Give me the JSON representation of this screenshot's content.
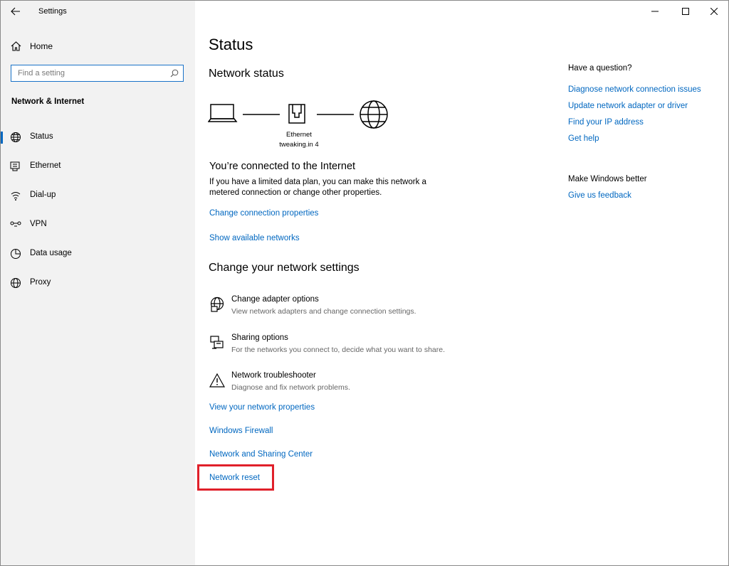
{
  "window": {
    "title": "Settings"
  },
  "sidebar": {
    "home_label": "Home",
    "search_placeholder": "Find a setting",
    "section_title": "Network & Internet",
    "items": [
      {
        "label": "Status",
        "icon": "globe-status-icon",
        "active": true
      },
      {
        "label": "Ethernet",
        "icon": "ethernet-icon"
      },
      {
        "label": "Dial-up",
        "icon": "dialup-icon"
      },
      {
        "label": "VPN",
        "icon": "vpn-icon"
      },
      {
        "label": "Data usage",
        "icon": "data-usage-icon"
      },
      {
        "label": "Proxy",
        "icon": "globe-icon"
      }
    ]
  },
  "main": {
    "title": "Status",
    "network_status_heading": "Network status",
    "diagram": {
      "adapter_name": "Ethernet",
      "network_name": "tweaking.in 4"
    },
    "connected_heading": "You’re connected to the Internet",
    "connected_text": "If you have a limited data plan, you can make this network a metered connection or change other properties.",
    "change_connection_link": "Change connection properties",
    "show_networks_link": "Show available networks",
    "change_settings_heading": "Change your network settings",
    "options": [
      {
        "title": "Change adapter options",
        "desc": "View network adapters and change connection settings.",
        "icon": "adapter-globe-icon"
      },
      {
        "title": "Sharing options",
        "desc": "For the networks you connect to, decide what you want to share.",
        "icon": "sharing-icon"
      },
      {
        "title": "Network troubleshooter",
        "desc": "Diagnose and fix network problems.",
        "icon": "warning-icon"
      }
    ],
    "links": {
      "view_properties": "View your network properties",
      "firewall": "Windows Firewall",
      "sharing_center": "Network and Sharing Center",
      "network_reset": "Network reset"
    }
  },
  "aside": {
    "question_heading": "Have a question?",
    "help_links": [
      "Diagnose network connection issues",
      "Update network adapter or driver",
      "Find your IP address",
      "Get help"
    ],
    "better_heading": "Make Windows better",
    "feedback_link": "Give us feedback"
  },
  "colors": {
    "accent": "#0067c0",
    "highlight": "#e0202a",
    "sidebar_bg": "#f2f2f2"
  }
}
